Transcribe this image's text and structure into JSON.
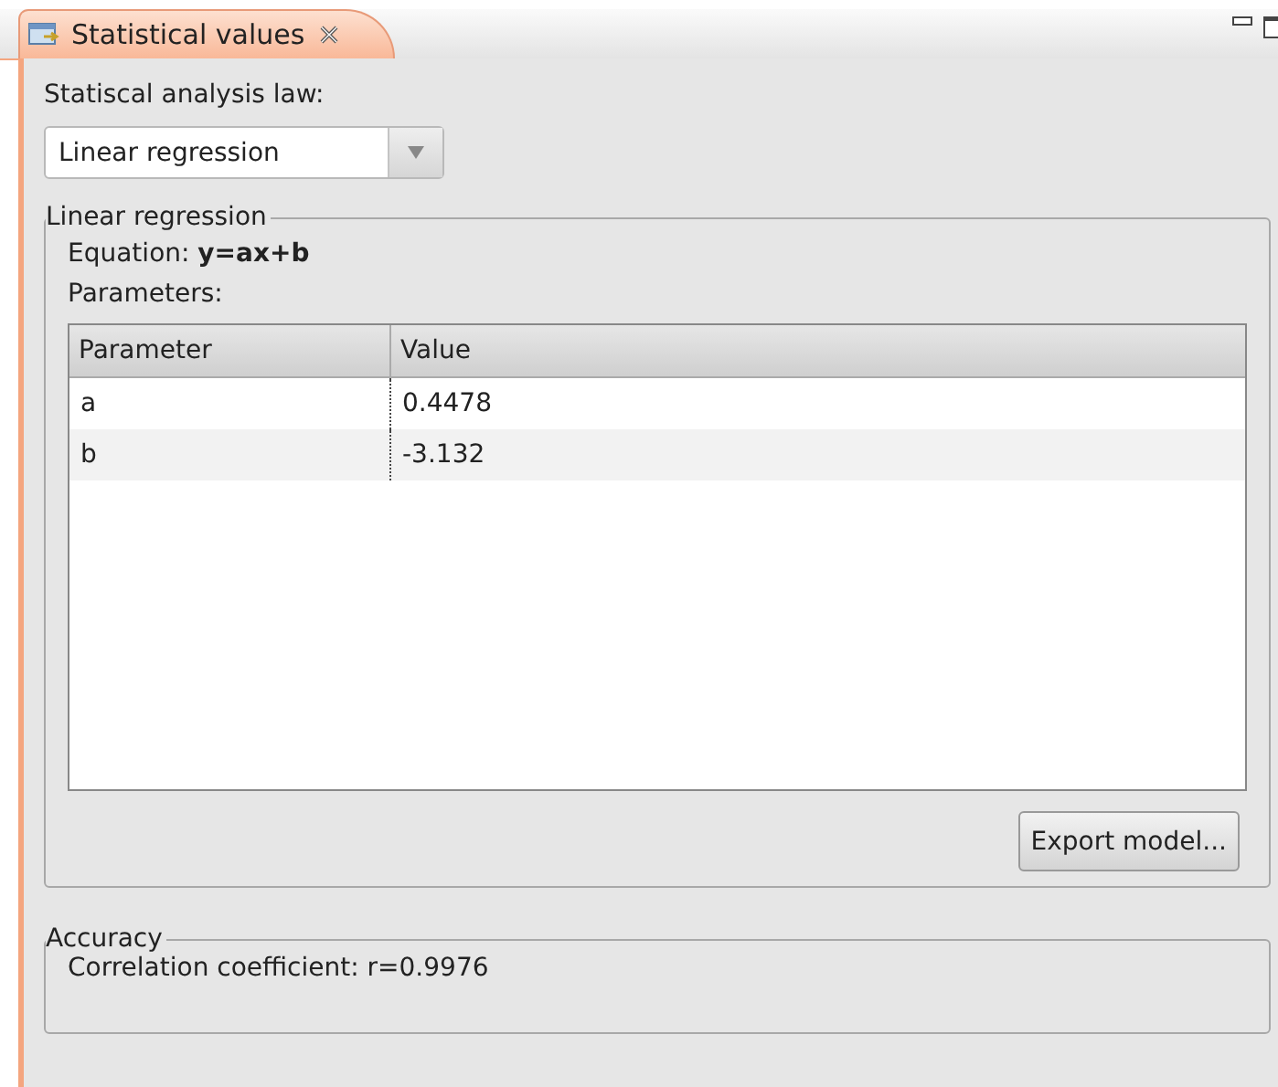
{
  "tab": {
    "title": "Statistical values",
    "selected": true
  },
  "law": {
    "label": "Statiscal analysis law:",
    "value": "Linear regression"
  },
  "model_group": {
    "title": "Linear regression",
    "equation": "Equation: **y=ax+b**",
    "parameters_label": "Parameters:",
    "table": {
      "columns": [
        "Parameter",
        "Value"
      ],
      "rows": [
        [
          "a",
          "0.4478"
        ],
        [
          "b",
          "-3.132"
        ]
      ]
    },
    "export_button": "Export model..."
  },
  "accuracy_group": {
    "title": "Accuracy",
    "text": "Correlation coefficient: r=0.9976"
  }
}
